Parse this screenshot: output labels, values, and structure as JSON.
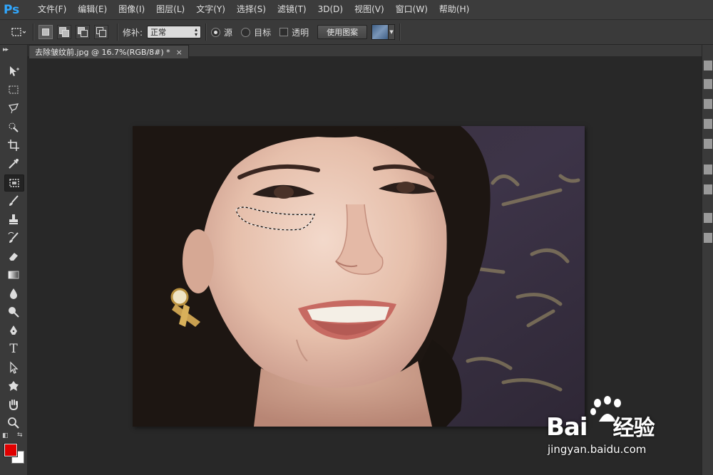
{
  "app": {
    "logo": "Ps"
  },
  "menu": [
    "文件(F)",
    "编辑(E)",
    "图像(I)",
    "图层(L)",
    "文字(Y)",
    "选择(S)",
    "滤镜(T)",
    "3D(D)",
    "视图(V)",
    "窗口(W)",
    "帮助(H)"
  ],
  "options": {
    "repair_label": "修补:",
    "repair_mode": "正常",
    "source_label": "源",
    "target_label": "目标",
    "transparent_label": "透明",
    "use_pattern_label": "使用图案",
    "selected_source": true,
    "transparent_checked": false
  },
  "document": {
    "tab_title": "去除皱纹前.jpg @ 16.7%(RGB/8#) *",
    "close_glyph": "×"
  },
  "colors": {
    "foreground": "#e00000",
    "background": "#ffffff",
    "accent": "#31a8ff"
  },
  "tools": [
    {
      "name": "move-tool",
      "icon": "move-icon"
    },
    {
      "name": "marquee-tool",
      "icon": "marquee-icon"
    },
    {
      "name": "lasso-tool",
      "icon": "lasso-icon"
    },
    {
      "name": "quick-selection-tool",
      "icon": "quick-selection-icon"
    },
    {
      "name": "crop-tool",
      "icon": "crop-icon"
    },
    {
      "name": "eyedropper-tool",
      "icon": "eyedropper-icon"
    },
    {
      "name": "patch-tool",
      "icon": "patch-icon",
      "active": true
    },
    {
      "name": "brush-tool",
      "icon": "brush-icon"
    },
    {
      "name": "clone-stamp-tool",
      "icon": "stamp-icon"
    },
    {
      "name": "history-brush-tool",
      "icon": "history-brush-icon"
    },
    {
      "name": "eraser-tool",
      "icon": "eraser-icon"
    },
    {
      "name": "gradient-tool",
      "icon": "gradient-icon"
    },
    {
      "name": "blur-tool",
      "icon": "blur-icon"
    },
    {
      "name": "dodge-tool",
      "icon": "dodge-icon"
    },
    {
      "name": "pen-tool",
      "icon": "pen-icon"
    },
    {
      "name": "type-tool",
      "icon": "type-icon"
    },
    {
      "name": "path-selection-tool",
      "icon": "path-selection-icon"
    },
    {
      "name": "shape-tool",
      "icon": "shape-icon"
    },
    {
      "name": "hand-tool",
      "icon": "hand-icon"
    },
    {
      "name": "zoom-tool",
      "icon": "zoom-icon"
    }
  ],
  "type_tool_glyph": "T",
  "watermark": {
    "brand": "Bai",
    "brand_suffix": "经验",
    "url": "jingyan.baidu.com"
  }
}
